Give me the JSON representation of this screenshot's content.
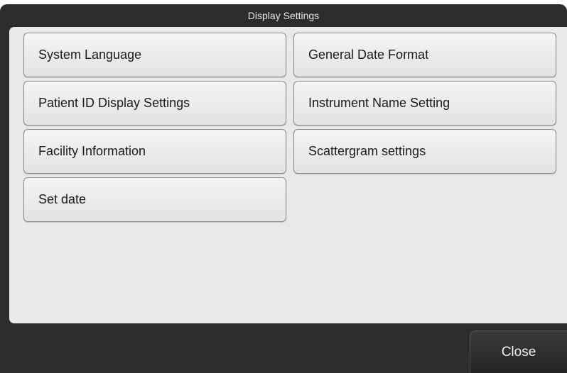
{
  "window": {
    "title": "Display Settings"
  },
  "menu": {
    "items": [
      {
        "label": "System Language"
      },
      {
        "label": "General Date Format"
      },
      {
        "label": "Patient ID Display Settings"
      },
      {
        "label": "Instrument Name Setting"
      },
      {
        "label": "Facility Information"
      },
      {
        "label": "Scattergram settings"
      },
      {
        "label": "Set date"
      }
    ]
  },
  "footer": {
    "close_label": "Close"
  }
}
